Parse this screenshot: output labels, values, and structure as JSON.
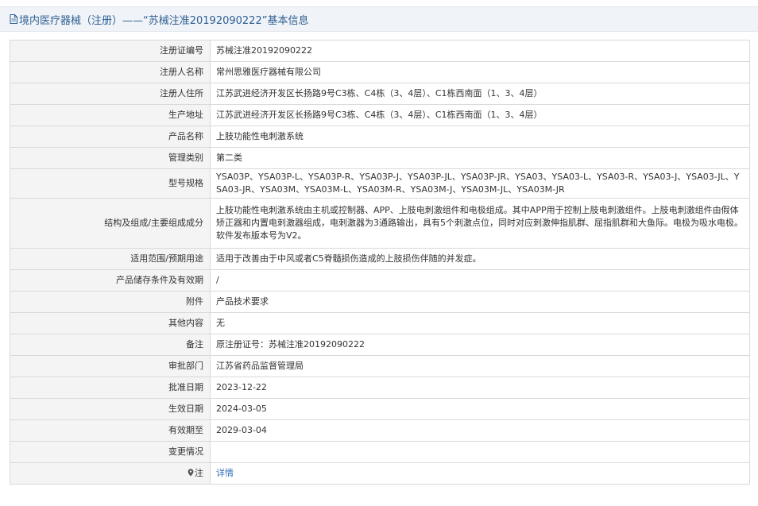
{
  "header": {
    "title": "境内医疗器械（注册）——“苏械注准20192090222”基本信息",
    "icon": "document-icon"
  },
  "rows": [
    {
      "label": "注册证编号",
      "value": "苏械注准20192090222"
    },
    {
      "label": "注册人名称",
      "value": "常州思雅医疗器械有限公司"
    },
    {
      "label": "注册人住所",
      "value": "江苏武进经济开发区长扬路9号C3栋、C4栋（3、4层）、C1栋西南面（1、3、4层）"
    },
    {
      "label": "生产地址",
      "value": "江苏武进经济开发区长扬路9号C3栋、C4栋（3、4层）、C1栋西南面（1、3、4层）"
    },
    {
      "label": "产品名称",
      "value": "上肢功能性电刺激系统"
    },
    {
      "label": "管理类别",
      "value": "第二类"
    },
    {
      "label": "型号规格",
      "value": "YSA03P、YSA03P-L、YSA03P-R、YSA03P-J、YSA03P-JL、YSA03P-JR、YSA03、YSA03-L、YSA03-R、YSA03-J、YSA03-JL、YSA03-JR、YSA03M、YSA03M-L、YSA03M-R、YSA03M-J、YSA03M-JL、YSA03M-JR"
    },
    {
      "label": "结构及组成/主要组成成分",
      "value": "上肢功能性电刺激系统由主机或控制器、APP、上肢电刺激组件和电极组成。其中APP用于控制上肢电刺激组件。上肢电刺激组件由假体矫正器和内置电刺激器组成，电刺激器为3通路输出，具有5个刺激点位，同时对应刺激伸指肌群、屈指肌群和大鱼际。电极为吸水电极。软件发布版本号为V2。"
    },
    {
      "label": "适用范围/预期用途",
      "value": "适用于改善由于中风或者C5脊髓损伤造成的上肢损伤伴随的并发症。"
    },
    {
      "label": "产品储存条件及有效期",
      "value": "/"
    },
    {
      "label": "附件",
      "value": "产品技术要求"
    },
    {
      "label": "其他内容",
      "value": "无"
    },
    {
      "label": "备注",
      "value": "原注册证号：苏械注准20192090222"
    },
    {
      "label": "审批部门",
      "value": "江苏省药品监督管理局"
    },
    {
      "label": "批准日期",
      "value": "2023-12-22"
    },
    {
      "label": "生效日期",
      "value": "2024-03-05"
    },
    {
      "label": "有效期至",
      "value": "2029-03-04"
    },
    {
      "label": "变更情况",
      "value": ""
    }
  ],
  "note_row": {
    "icon": "pin-icon",
    "label": "注",
    "link_text": "详情"
  },
  "colors": {
    "header_bg": "#f0f3f7",
    "title_color": "#2d5f93",
    "label_bg": "#f4f4f4",
    "border": "#d9d9d9",
    "link": "#2d6fb5"
  }
}
